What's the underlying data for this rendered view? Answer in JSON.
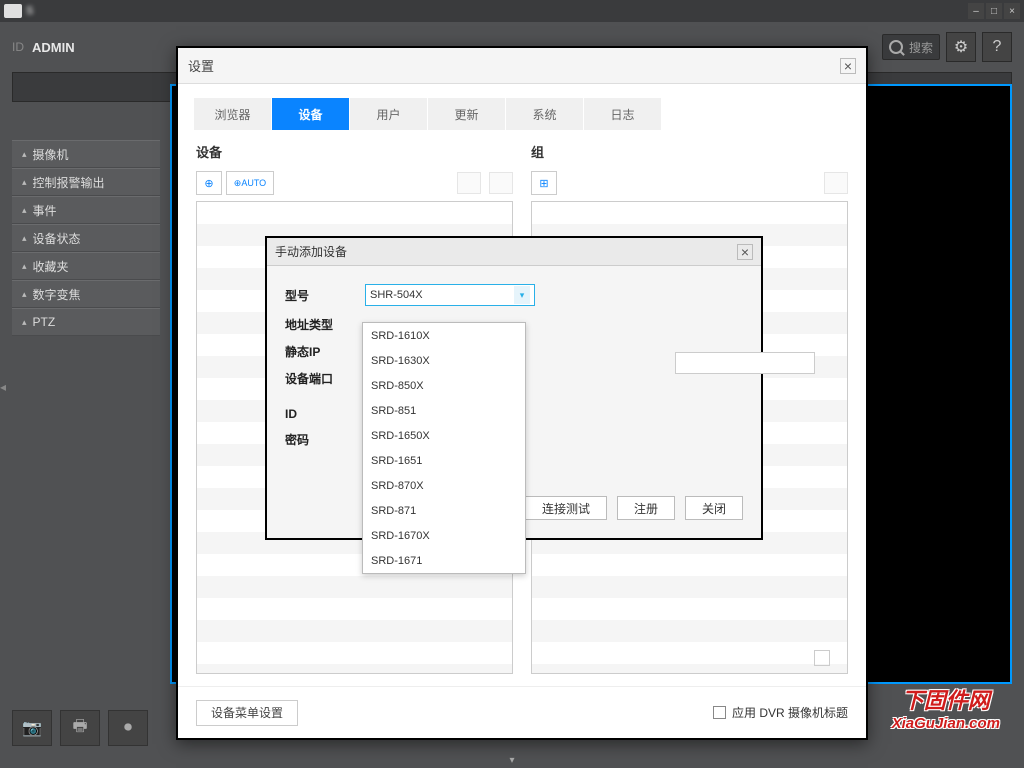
{
  "titlebar": {
    "logo_text": "S"
  },
  "user": {
    "id_label": "ID",
    "id_value": "ADMIN",
    "search_placeholder": "搜索"
  },
  "sidebar": {
    "items": [
      {
        "label": "摄像机"
      },
      {
        "label": "控制报警输出"
      },
      {
        "label": "事件"
      },
      {
        "label": "设备状态"
      },
      {
        "label": "收藏夹"
      },
      {
        "label": "数字变焦"
      },
      {
        "label": "PTZ"
      }
    ]
  },
  "settings": {
    "title": "设置",
    "tabs": [
      "浏览器",
      "设备",
      "用户",
      "更新",
      "系统",
      "日志"
    ],
    "active_tab": 1,
    "device_col": "设备",
    "group_col": "组",
    "auto_label": "AUTO",
    "menu_settings": "设备菜单设置",
    "apply_dvr": "应用 DVR 摄像机标题"
  },
  "add_device": {
    "title": "手动添加设备",
    "labels": {
      "model": "型号",
      "addr_type": "地址类型",
      "static_ip": "静态IP",
      "port": "设备端口",
      "id": "ID",
      "password": "密码"
    },
    "selected_model": "SHR-504X",
    "buttons": {
      "test": "连接测试",
      "register": "注册",
      "close": "关闭"
    }
  },
  "dropdown_options": [
    "SRD-1610X",
    "SRD-1630X",
    "SRD-850X",
    "SRD-851",
    "SRD-1650X",
    "SRD-1651",
    "SRD-870X",
    "SRD-871",
    "SRD-1670X",
    "SRD-1671"
  ],
  "watermark": {
    "cn": "下固件网",
    "en": "XiaGuJian.com"
  }
}
